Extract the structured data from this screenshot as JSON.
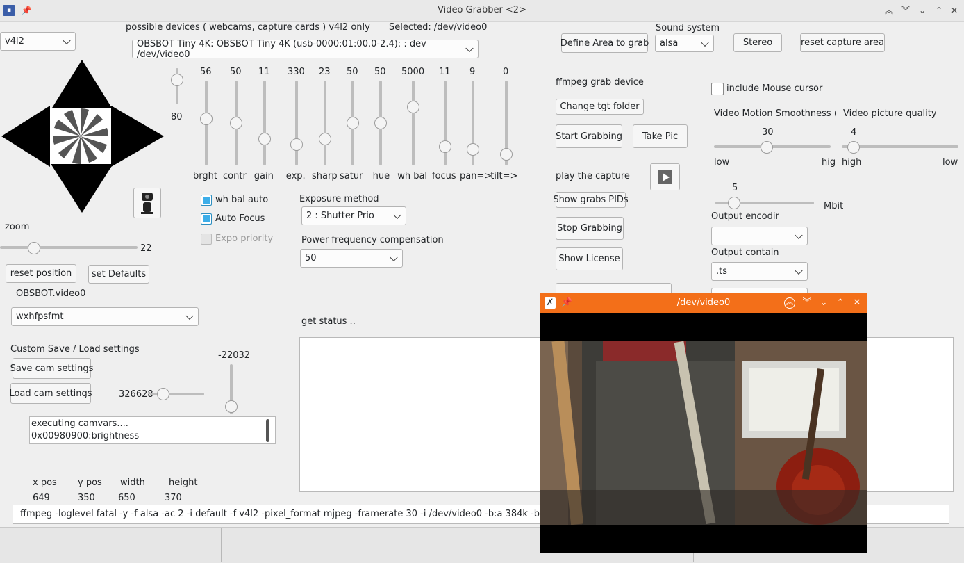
{
  "window": {
    "title": "Video Grabber <2>",
    "controls": [
      "keep-above",
      "keep-below",
      "minimize",
      "maximize",
      "close"
    ]
  },
  "left": {
    "backend_value": "v4l2",
    "zoom_label": "zoom",
    "zoom_value": "22",
    "zoom_fraction": 0.22,
    "reset_position": "reset position",
    "set_defaults": "set Defaults",
    "device_name": "OBSBOT.video0",
    "format_value": "wxhfpsfmt",
    "custom_label": "Custom Save / Load settings",
    "save_cam": "Save cam settings",
    "load_cam": "Load cam settings",
    "pan_value": "326628",
    "tilt_value": "-22032",
    "log_lines": [
      "executing camvars....",
      "0x00980900:brightness"
    ],
    "pos_headers": [
      "x  pos",
      "y pos",
      "width",
      "height"
    ],
    "pos_values": [
      "649",
      "350",
      "650",
      "370"
    ]
  },
  "devices": {
    "header": "possible devices ( webcams, capture cards ) v4l2 only",
    "selected": "Selected: /dev/video0",
    "device_value": "OBSBOT Tiny 4K: OBSBOT Tiny 4K (usb-0000:01:00.0-2.4): : dev /dev/video0"
  },
  "sliders": [
    {
      "name": "brght",
      "value": "56",
      "fraction": 0.56
    },
    {
      "name": "contr",
      "value": "50",
      "fraction": 0.5
    },
    {
      "name": "gain",
      "value": "11",
      "fraction": 0.28
    },
    {
      "name": "exp.",
      "value": "330",
      "fraction": 0.2
    },
    {
      "name": "sharp",
      "value": "23",
      "fraction": 0.28
    },
    {
      "name": "satur",
      "value": "50",
      "fraction": 0.5
    },
    {
      "name": "hue",
      "value": "50",
      "fraction": 0.5
    },
    {
      "name": "wh bal",
      "value": "5000",
      "fraction": 0.72
    },
    {
      "name": "focus",
      "value": "11",
      "fraction": 0.17
    },
    {
      "name": "pan=>",
      "value": "9",
      "fraction": 0.13
    },
    {
      "name": "tilt=>",
      "value": "0",
      "fraction": 0.07
    }
  ],
  "top_slider_value": "80",
  "checks": {
    "wh_bal_auto": "wh bal auto",
    "auto_focus": "Auto Focus",
    "expo_priority": "Expo priority"
  },
  "exposure": {
    "label": "Exposure method",
    "value": "2 : Shutter Prio",
    "power_label": "Power frequency compensation",
    "power_value": "50"
  },
  "status": {
    "label": "get status .."
  },
  "grab": {
    "define_area": "Define Area to grab",
    "sound_label": "Sound system",
    "sound_value": "alsa",
    "stereo": "Stereo",
    "reset_capture": "reset capture area",
    "ffmpeg_device": "ffmpeg grab device",
    "change_tgt": "Change tgt  folder",
    "start": "Start Grabbing",
    "take_pic": "Take Pic",
    "play_label": "play the capture",
    "show_pids": "Show grabs PIDs",
    "stop": "Stop Grabbing",
    "license": "Show License",
    "mouse_cursor": "include Mouse cursor",
    "smooth_label": "Video Motion Smoothness (fp",
    "smooth_value": "30",
    "smooth_low": "low",
    "smooth_high": "hig",
    "quality_label": "Video picture quality",
    "quality_value": "4",
    "quality_high": "high",
    "quality_low": "low",
    "mbit_value": "5",
    "mbit_unit": "Mbit",
    "encoder_label": "Output encodir",
    "encoder_value": "",
    "container_label": "Output contain",
    "container_value": ".ts"
  },
  "command": "ffmpeg -loglevel fatal -y  -f alsa -ac 2 -i default  -f v4l2 -pixel_format mjpeg -framerate 30 -i /dev/video0 -b:a 384k -b",
  "popup": {
    "title": "/dev/video0"
  }
}
